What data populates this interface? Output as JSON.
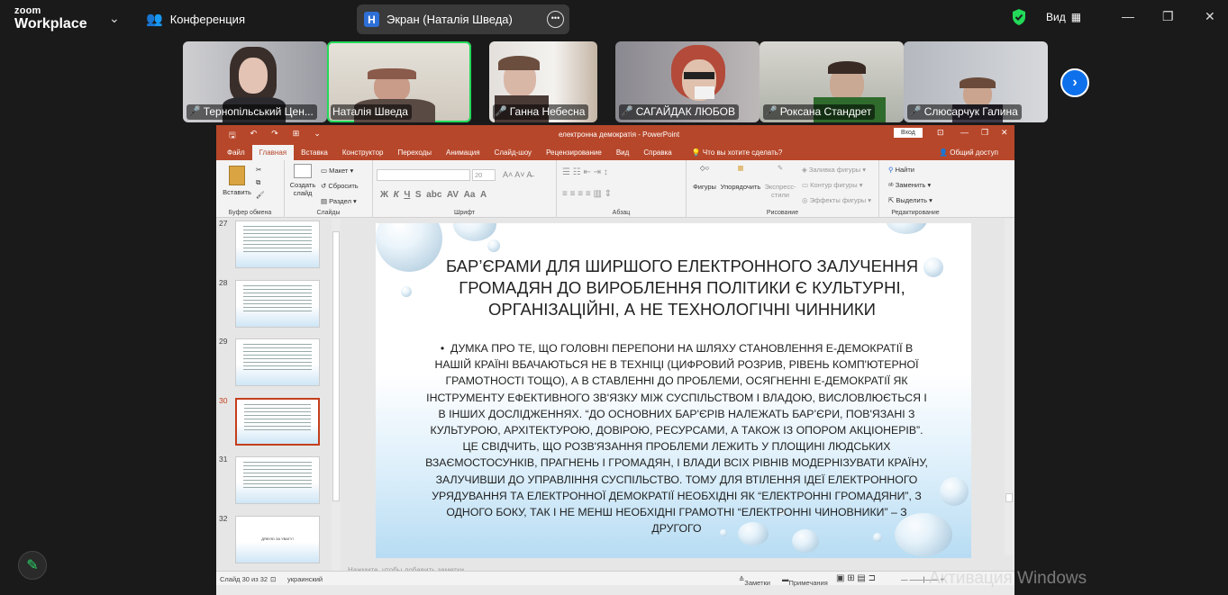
{
  "zoom": {
    "logo_line1": "zoom",
    "logo_line2": "Workplace",
    "meeting_label": "Конференция",
    "share_badge": "H",
    "share_label": "Экран (Наталія Шведа)",
    "view_label": "Вид",
    "participants": [
      {
        "name": "Тернопільський Цен...",
        "muted": true,
        "active": false
      },
      {
        "name": "Наталія Шведа",
        "muted": false,
        "active": true
      },
      {
        "name": "Ганна Небесна",
        "muted": true,
        "active": false
      },
      {
        "name": "САГАЙДАК ЛЮБОВ",
        "muted": true,
        "active": false
      },
      {
        "name": "Роксана Стандрет",
        "muted": true,
        "active": false
      },
      {
        "name": "Слюсарчук Галина",
        "muted": true,
        "active": false
      }
    ],
    "accent_color": "#0e71eb",
    "active_speaker_color": "#23d959"
  },
  "ppt": {
    "window_title": "електронна демократія - PowerPoint",
    "signin_label": "Вход",
    "tabs": [
      "Файл",
      "Главная",
      "Вставка",
      "Конструктор",
      "Переходы",
      "Анимация",
      "Слайд-шоу",
      "Рецензирование",
      "Вид",
      "Справка"
    ],
    "selected_tab": "Главная",
    "tell_me": "Что вы хотите сделать?",
    "share_label": "Общий доступ",
    "ribbon": {
      "clipboard": {
        "paste": "Вставить",
        "group": "Буфер обмена"
      },
      "slides": {
        "new_slide": "Создать слайд",
        "layout": "Макет",
        "reset": "Сбросить",
        "section": "Раздел",
        "group": "Слайды"
      },
      "font": {
        "size": "20",
        "group": "Шрифт"
      },
      "paragraph": {
        "group": "Абзац"
      },
      "drawing": {
        "shapes": "Фигуры",
        "arrange": "Упорядочить",
        "quick_styles": "Экспресс-стили",
        "fill": "Заливка фигуры",
        "outline": "Контур фигуры",
        "effects": "Эффекты фигуры",
        "group": "Рисование"
      },
      "editing": {
        "find": "Найти",
        "replace": "Заменить",
        "select": "Выделить",
        "group": "Редактирование"
      }
    },
    "thumbnails": [
      {
        "number": "27",
        "current": false
      },
      {
        "number": "28",
        "current": false
      },
      {
        "number": "29",
        "current": false
      },
      {
        "number": "30",
        "current": true
      },
      {
        "number": "31",
        "current": false
      },
      {
        "number": "32",
        "current": false
      }
    ],
    "slide": {
      "title": "БАР’ЄРАМИ ДЛЯ ШИРШОГО ЕЛЕКТРОННОГО ЗАЛУЧЕННЯ ГРОМАДЯН ДО ВИРОБЛЕННЯ ПОЛІТИКИ Є КУЛЬТУРНІ, ОРГАНІЗАЦІЙНІ, А НЕ ТЕХНОЛОГІЧНІ ЧИННИКИ",
      "bullet": "•",
      "body": "ДУМКА ПРО ТЕ, ЩО ГОЛОВНІ ПЕРЕПОНИ НА ШЛЯХУ СТАНОВЛЕННЯ Е-ДЕМОКРАТІЇ В НАШІЙ КРАЇНІ ВБАЧАЮТЬСЯ НЕ В ТЕХНІЦІ (ЦИФРОВИЙ РОЗРИВ, РІВЕНЬ КОМП'ЮТЕРНОЇ ГРАМОТНОСТІ ТОЩО), А В СТАВЛЕННІ ДО ПРОБЛЕМИ, ОСЯГНЕННІ Е-ДЕМОКРАТІЇ ЯК ІНСТРУМЕНТУ ЕФЕКТИВНОГО ЗВ'ЯЗКУ МІЖ СУСПІЛЬСТВОМ І ВЛАДОЮ, ВИСЛОВЛЮЄТЬСЯ І В ІНШИХ ДОСЛІДЖЕННЯХ. “ДО ОСНОВНИХ БАР'ЄРІВ НАЛЕЖАТЬ БАР’ЄРИ, ПОВ'ЯЗАНІ З КУЛЬТУРОЮ, АРХІТЕКТУРОЮ, ДОВІРОЮ, РЕСУРСАМИ, А ТАКОЖ ІЗ ОПОРОМ АКЦІОНЕРІВ”. ЦЕ СВІДЧИТЬ, ЩО РОЗВ'ЯЗАННЯ ПРОБЛЕМИ ЛЕЖИТЬ У ПЛОЩИНІ ЛЮДСЬКИХ ВЗАЄМОСТОСУНКІВ, ПРАГНЕНЬ І ГРОМАДЯН, І ВЛАДИ ВСІХ РІВНІВ МОДЕРНІЗУВАТИ КРАЇНУ, ЗАЛУЧИВШИ ДО УПРАВЛІННЯ СУСПІЛЬСТВО. ТОМУ ДЛЯ ВТІЛЕННЯ ІДЕЇ ЕЛЕКТРОННОГО УРЯДУВАННЯ ТА ЕЛЕКТРОННОЇ ДЕМОКРАТІЇ НЕОБХІДНІ ЯК “ЕЛЕКТРОННІ ГРОМАДЯНИ”, З ОДНОГО БОКУ, ТАК І НЕ МЕНШ НЕОБХІДНІ ГРАМОТНІ “ЕЛЕКТРОННІ ЧИНОВНИКИ” – З ДРУГОГО"
    },
    "last_thumb_text": "ДЯКУЮ ЗА УВАГУ!",
    "notes_placeholder": "Нажмите, чтобы добавить заметки",
    "status": {
      "slide_counter": "Слайд 30 из 32",
      "language": "украинский",
      "notes": "Заметки",
      "comments": "Примечания"
    },
    "accent_color": "#b7472a"
  },
  "os_watermark": "Активация Windows"
}
